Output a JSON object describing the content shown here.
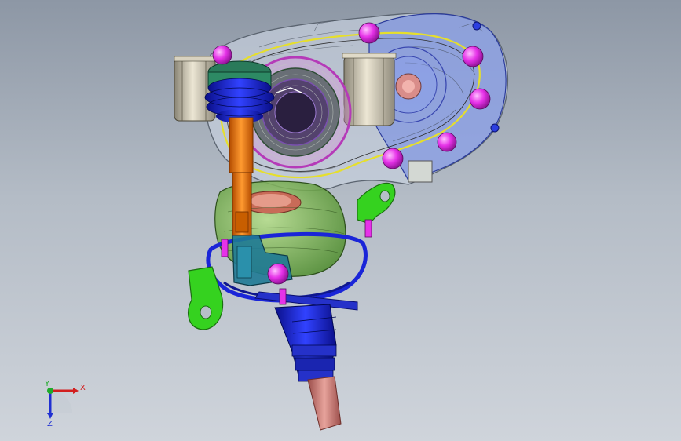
{
  "viewport": {
    "background_top": "#8d97a5",
    "background_bottom": "#cfd4db"
  },
  "triad": {
    "x_label": "X",
    "y_label": "Y",
    "z_label": "Z",
    "x_color": "#d21f1f",
    "y_color": "#1faa2a",
    "z_color": "#1f2fd2"
  },
  "model": {
    "colors": {
      "housing_fill": "#c7cfdd",
      "gear_housing": "#5f78d8",
      "bolts": "#e632e8",
      "orange_shaft": "#f07a10",
      "bellows": "#1a25d8",
      "green_bracket": "#35d21f",
      "motor": "#6fae3a",
      "connector": "#1f7a95",
      "pink_shaft": "#d8857e",
      "bearing": "#c9c2ae"
    }
  }
}
